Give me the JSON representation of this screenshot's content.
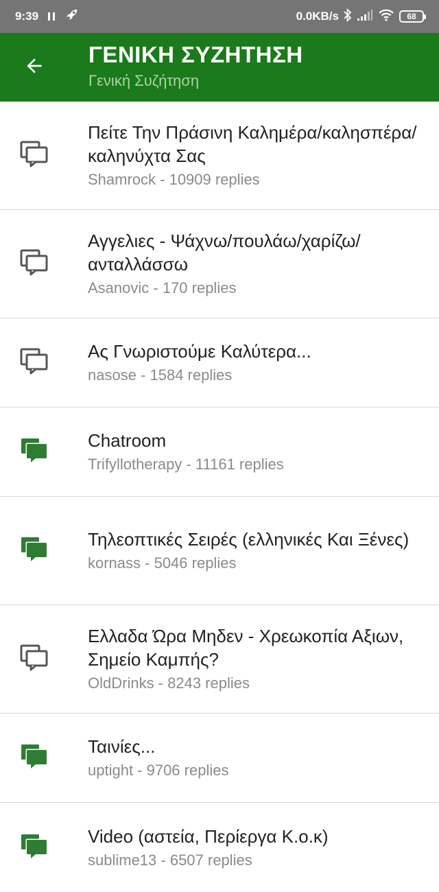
{
  "status_bar": {
    "time": "9:39",
    "network_speed": "0.0KB/s",
    "battery": "68"
  },
  "app_bar": {
    "title": "ΓΕΝΙΚΗ ΣΥΖΗΤΗΣΗ",
    "subtitle": "Γενική Συζήτηση"
  },
  "colors": {
    "primary": "#1b7a1b",
    "unread_icon": "#2e7d32",
    "read_icon": "#555555"
  },
  "topics": [
    {
      "title": "Πείτε Την Πράσινη Καλημέρα/καλησπέρα/καληνύχτα Σας",
      "meta": "Shamrock - 10909 replies",
      "icon": "chat-outline-icon"
    },
    {
      "title": "Αγγελιες - Ψάχνω/πουλάω/χαρίζω/ανταλλάσσω",
      "meta": "Asanovic - 170 replies",
      "icon": "chat-outline-icon"
    },
    {
      "title": "Ας Γνωριστούμε Καλύτερα...",
      "meta": "nasose - 1584 replies",
      "icon": "chat-outline-icon"
    },
    {
      "title": "Chatroom",
      "meta": "Trifyllotherapy - 11161 replies",
      "icon": "chat-filled-icon"
    },
    {
      "title": "Τηλεοπτικές Σειρές (ελληνικές Και Ξένες)",
      "meta": "kornass - 5046 replies",
      "icon": "chat-filled-icon"
    },
    {
      "title": "Ελλαδα Ώρα Μηδεν - Χρεωκοπία Αξιων, Σημείο Καμπής?",
      "meta": "OldDrinks - 8243 replies",
      "icon": "chat-outline-icon"
    },
    {
      "title": "Ταινίες...",
      "meta": "uptight - 9706 replies",
      "icon": "chat-filled-icon"
    },
    {
      "title": "Video (αστεία, Περίεργα Κ.ο.κ)",
      "meta": "sublime13 - 6507 replies",
      "icon": "chat-filled-icon"
    }
  ]
}
